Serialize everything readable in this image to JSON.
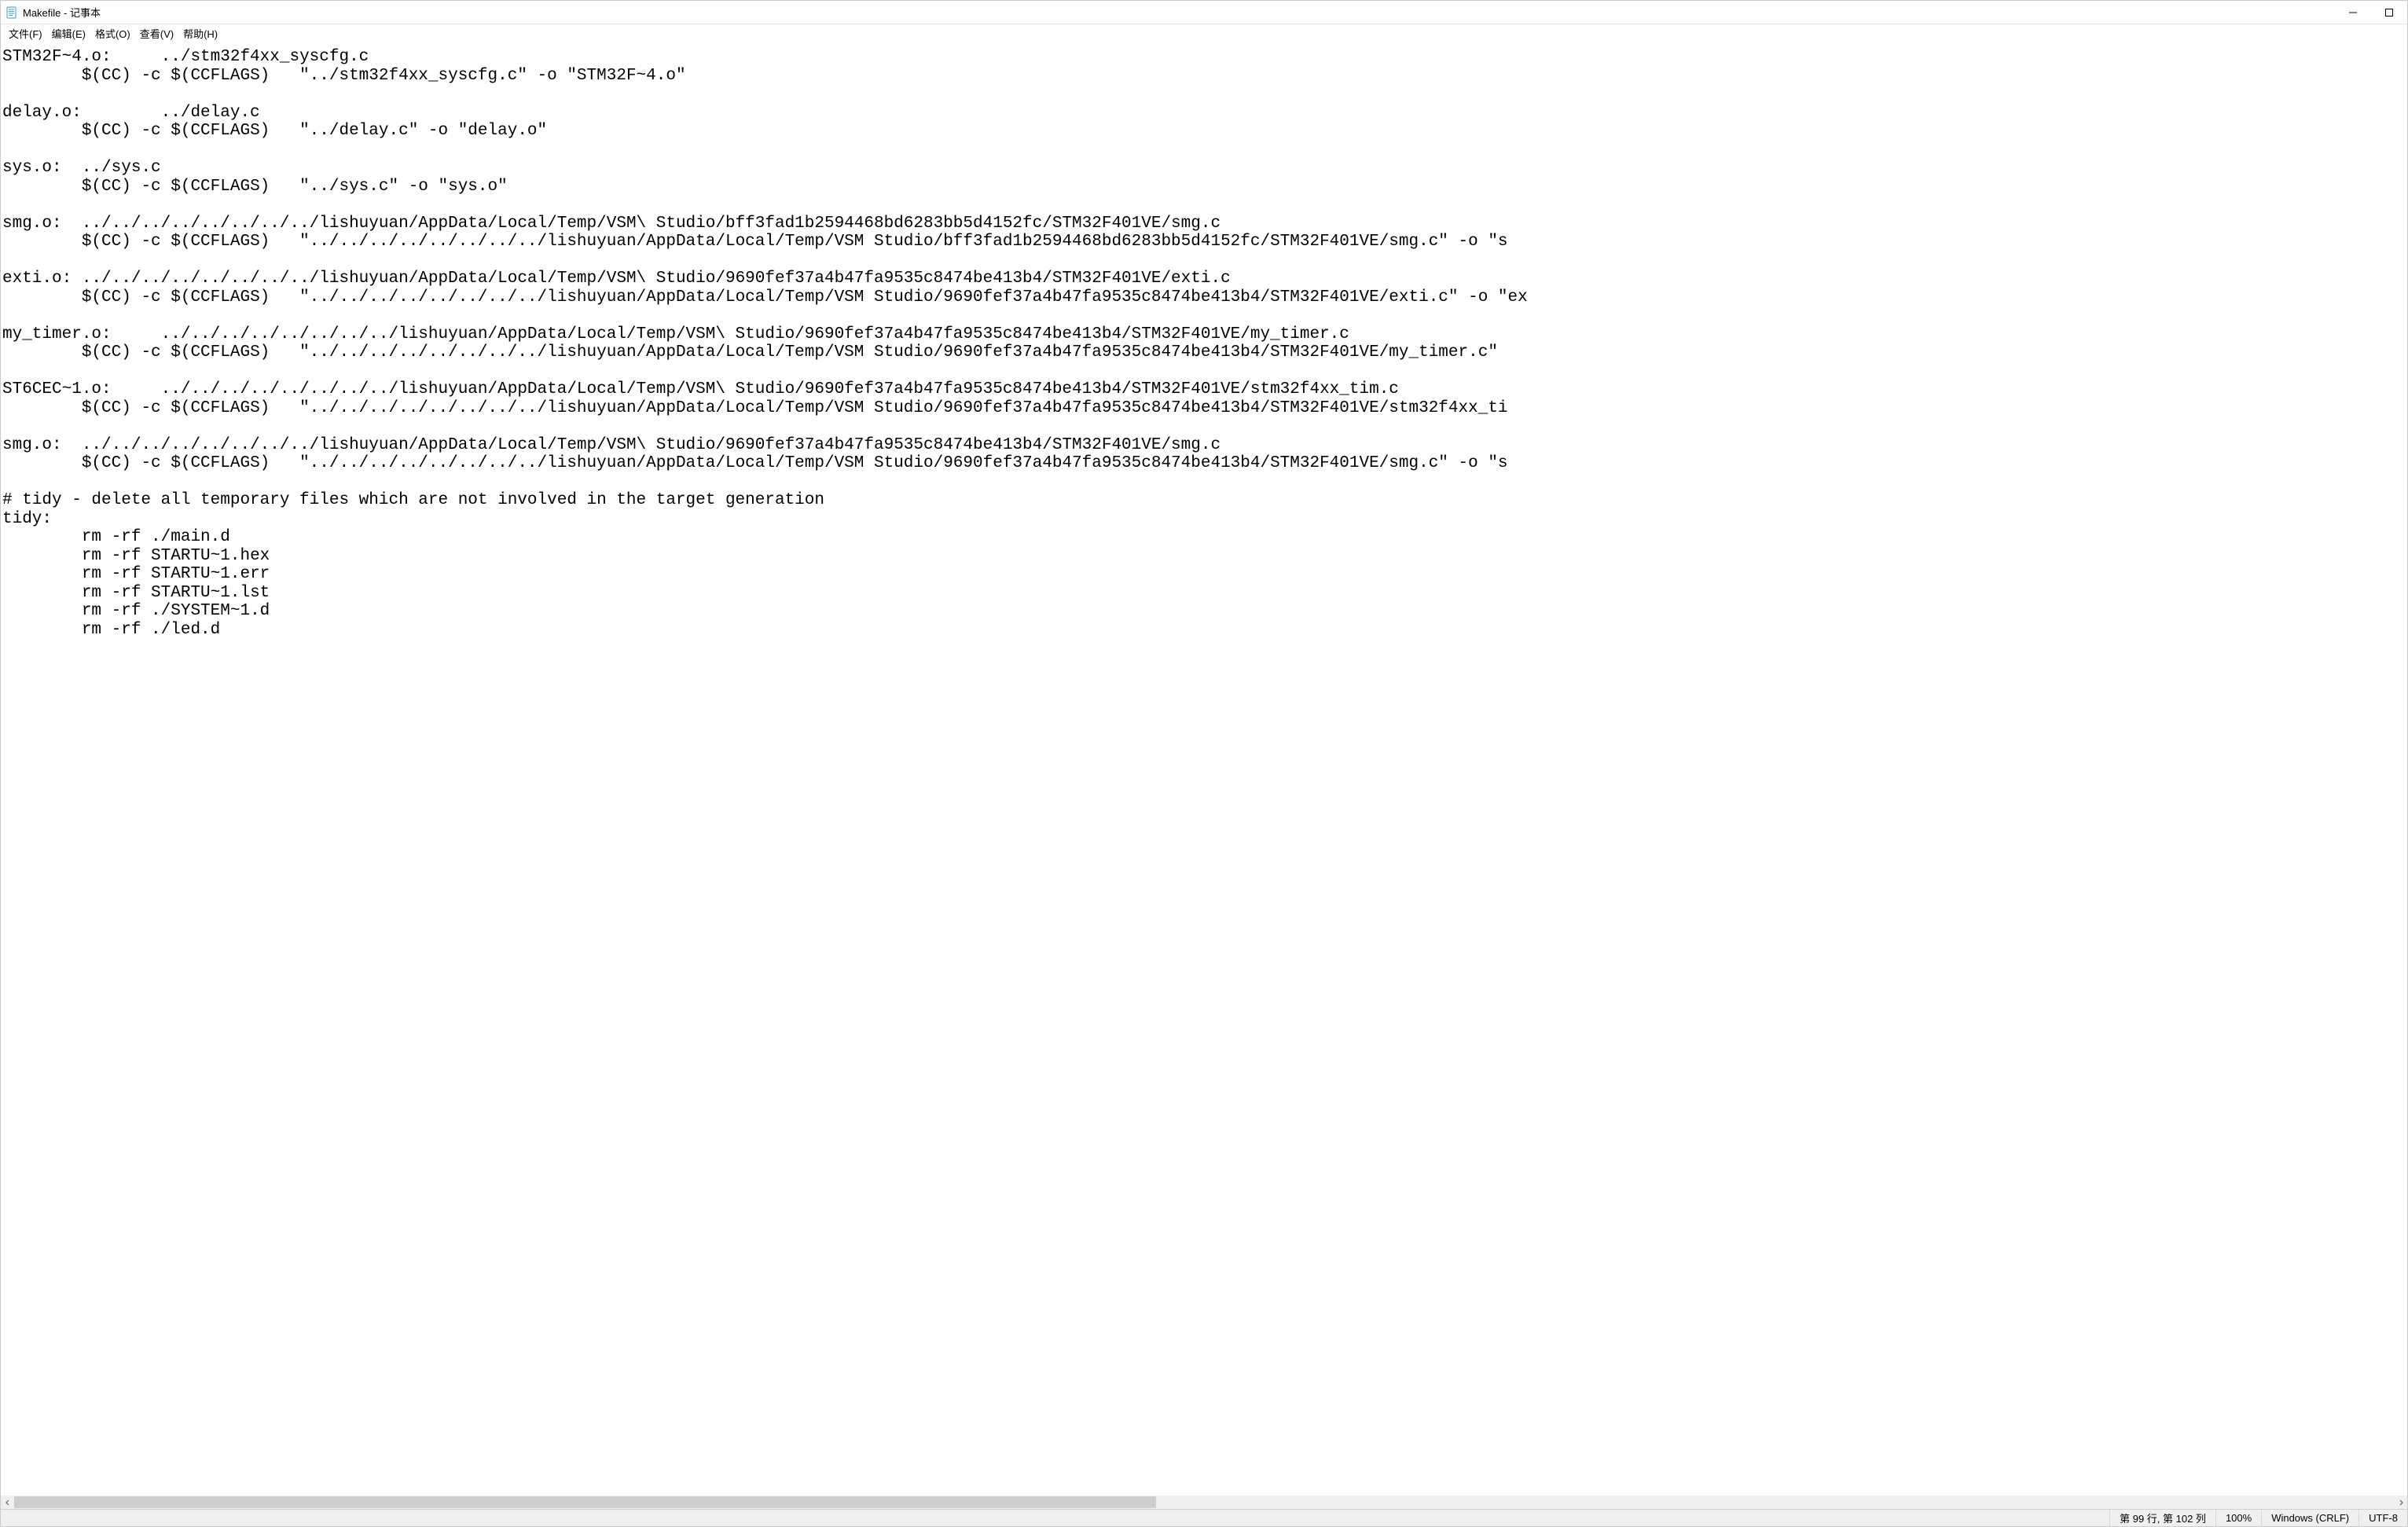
{
  "window": {
    "title": "Makefile - 记事本"
  },
  "menu": {
    "file": "文件(F)",
    "edit": "编辑(E)",
    "format": "格式(O)",
    "view": "查看(V)",
    "help": "帮助(H)"
  },
  "editor": {
    "text": "STM32F~4.o:\t../stm32f4xx_syscfg.c\n\t$(CC) -c $(CCFLAGS)   \"../stm32f4xx_syscfg.c\" -o \"STM32F~4.o\"\n\ndelay.o:\t../delay.c\n\t$(CC) -c $(CCFLAGS)   \"../delay.c\" -o \"delay.o\"\n\nsys.o:\t../sys.c\n\t$(CC) -c $(CCFLAGS)   \"../sys.c\" -o \"sys.o\"\n\nsmg.o:\t../../../../../../../../lishuyuan/AppData/Local/Temp/VSM\\ Studio/bff3fad1b2594468bd6283bb5d4152fc/STM32F401VE/smg.c\n\t$(CC) -c $(CCFLAGS)   \"../../../../../../../../lishuyuan/AppData/Local/Temp/VSM Studio/bff3fad1b2594468bd6283bb5d4152fc/STM32F401VE/smg.c\" -o \"s\n\nexti.o:\t../../../../../../../../lishuyuan/AppData/Local/Temp/VSM\\ Studio/9690fef37a4b47fa9535c8474be413b4/STM32F401VE/exti.c\n\t$(CC) -c $(CCFLAGS)   \"../../../../../../../../lishuyuan/AppData/Local/Temp/VSM Studio/9690fef37a4b47fa9535c8474be413b4/STM32F401VE/exti.c\" -o \"ex\n\nmy_timer.o:\t../../../../../../../../lishuyuan/AppData/Local/Temp/VSM\\ Studio/9690fef37a4b47fa9535c8474be413b4/STM32F401VE/my_timer.c\n\t$(CC) -c $(CCFLAGS)   \"../../../../../../../../lishuyuan/AppData/Local/Temp/VSM Studio/9690fef37a4b47fa9535c8474be413b4/STM32F401VE/my_timer.c\"\n\nST6CEC~1.o:\t../../../../../../../../lishuyuan/AppData/Local/Temp/VSM\\ Studio/9690fef37a4b47fa9535c8474be413b4/STM32F401VE/stm32f4xx_tim.c\n\t$(CC) -c $(CCFLAGS)   \"../../../../../../../../lishuyuan/AppData/Local/Temp/VSM Studio/9690fef37a4b47fa9535c8474be413b4/STM32F401VE/stm32f4xx_ti\n\nsmg.o:\t../../../../../../../../lishuyuan/AppData/Local/Temp/VSM\\ Studio/9690fef37a4b47fa9535c8474be413b4/STM32F401VE/smg.c\n\t$(CC) -c $(CCFLAGS)   \"../../../../../../../../lishuyuan/AppData/Local/Temp/VSM Studio/9690fef37a4b47fa9535c8474be413b4/STM32F401VE/smg.c\" -o \"s\n\n# tidy - delete all temporary files which are not involved in the target generation\ntidy:\n\trm -rf ./main.d\n\trm -rf STARTU~1.hex\n\trm -rf STARTU~1.err\n\trm -rf STARTU~1.lst\n\trm -rf ./SYSTEM~1.d\n\trm -rf ./led.d"
  },
  "status": {
    "position": "第 99 行, 第 102 列",
    "zoom": "100%",
    "line_ending": "Windows (CRLF)",
    "encoding": "UTF-8"
  }
}
